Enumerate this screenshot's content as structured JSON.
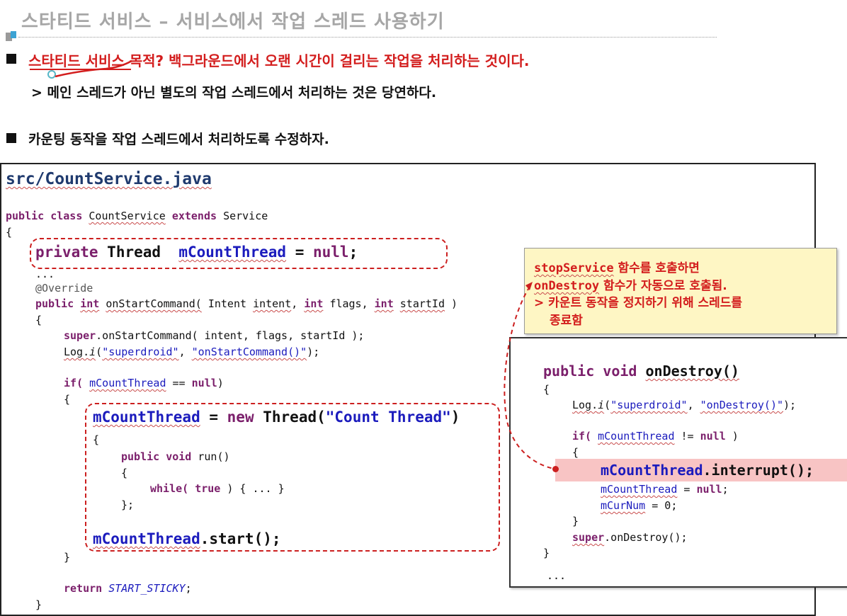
{
  "title": "스타티드 서비스 – 서비스에서 작업 스레드 사용하기",
  "bullets": {
    "b1_red": "스타티드 서비스 목적? 백그라운드에서 오랜 시간이 걸리는 작업을 처리하는 것이다.",
    "b1_sub": "> 메인 스레드가 아닌 별도의 작업 스레드에서 처리하는 것은 당연하다.",
    "b2": "카운팅 동작을 작업 스레드에서 처리하도록 수정하자."
  },
  "code": {
    "filename": "src/CountService.java",
    "kw_public": "public",
    "kw_class": "class",
    "class_name": "CountService",
    "kw_extends": "extends",
    "super_name": "Service",
    "open_brace": "{",
    "close_brace": "}",
    "kw_private": "private",
    "type_thread": "Thread",
    "field_thread": "mCountThread",
    "assign_eq": " = ",
    "kw_null": "null",
    "semicolon": ";",
    "ellipsis": "...",
    "override": "@Override",
    "kw_int": "int",
    "method_start": "onStartCommand(",
    "param_intent_type": "Intent",
    "param_intent": "intent",
    "param_flags": "flags",
    "param_startId": "startId",
    "close_paren": ")",
    "comma": ",",
    "kw_super": "super",
    "call_super_start": ".onStartCommand( intent, flags, startId );",
    "log_prefix": "Log.",
    "log_i": "i",
    "log_open": "(",
    "str_tag": "\"superdroid\"",
    "str_onstart": "\"onStartCommand()\"",
    "log_close": ");",
    "kw_if": "if(",
    "op_eqeq": " == ",
    "kw_new": "new",
    "thread_ctor": "Thread(",
    "str_count_thread": "\"Count Thread\"",
    "kw_void": "void",
    "run_sig": "run()",
    "kw_while": "while(",
    "kw_true": "true",
    "while_body": " ) { ... }",
    "close_semicolon": "};",
    "start_call": ".start();",
    "kw_return": "return",
    "start_sticky": "START_STICKY",
    "ondestroy_sig": "onDestroy()",
    "str_ondestroy": "\"onDestroy()\"",
    "op_neq": " != ",
    "interrupt_call": ".interrupt();",
    "field_curnum": "mCurNum",
    "zero": " = 0;",
    "super_ondestroy": ".onDestroy();",
    "side_ellipsis": "..."
  },
  "note": {
    "line1_mono": "stopService",
    "line1_text": " 함수를 호출하면",
    "line2_mono": "onDestroy",
    "line2_text": " 함수가 자동으로 호출됨.",
    "line3": "> 카운트 동작을 정지하기 위해 스레드를",
    "line4": "종료함"
  },
  "colors": {
    "keyword": "#7b1f6b",
    "field": "#1b1bbd",
    "accent_red": "#d31d1d",
    "note_bg": "#fef6c4",
    "highlight": "#f8c4c4"
  }
}
